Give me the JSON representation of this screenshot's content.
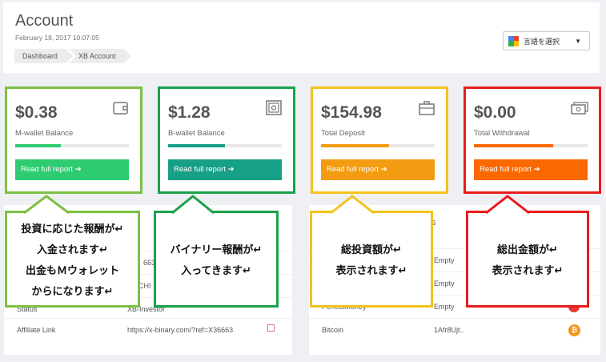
{
  "header": {
    "title": "Account",
    "datetime": "February 18, 2017 10:07:05",
    "breadcrumbs": [
      "Dashboard",
      "XB Account"
    ],
    "language_selector": "言語を選択"
  },
  "cards": [
    {
      "amount": "$0.38",
      "label": "M-wallet Balance",
      "button": "Read full report",
      "icon": "wallet-icon",
      "progress": 0.4,
      "accent": "#2ecc71",
      "outline": "#7dc142"
    },
    {
      "amount": "$1.28",
      "label": "B-wallet Balance",
      "button": "Read full report",
      "icon": "safe-icon",
      "progress": 0.5,
      "accent": "#16a085",
      "outline": "#1aa24a"
    },
    {
      "amount": "$154.98",
      "label": "Total Deposit",
      "button": "Read full report",
      "icon": "briefcase-icon",
      "progress": 0.6,
      "accent": "#f39c12",
      "outline": "#f5c21b"
    },
    {
      "amount": "$0.00",
      "label": "Total Withdrawal",
      "button": "Read full report",
      "icon": "cash-icon",
      "progress": 0.7,
      "accent": "#fa6800",
      "outline": "#e81c1c"
    }
  ],
  "left_panel": {
    "rows": [
      {
        "key": "",
        "value": "663"
      },
      {
        "key": "",
        "value": "CHI"
      },
      {
        "key": "Status",
        "value": "XB-Investor"
      },
      {
        "key": "Affiliate Link",
        "value": "https://x-binary.com/?ref=X36663"
      }
    ]
  },
  "right_panel": {
    "header_fragment": "s",
    "rows": [
      {
        "key": "",
        "value": "Empty"
      },
      {
        "key": "",
        "value": "Empty"
      },
      {
        "key": "PerfectMoney",
        "value": "Empty"
      },
      {
        "key": "Bitcoin",
        "value": "1Afr8Ujt.."
      }
    ]
  },
  "callouts": [
    {
      "lines": [
        "投資に応じた報酬が↵",
        "入金されます↵",
        "出金もＭウォレット",
        "からになります↵"
      ],
      "color": "#7dc142"
    },
    {
      "lines": [
        "バイナリー報酬が↵",
        "入ってきます↵"
      ],
      "color": "#1aa24a"
    },
    {
      "lines": [
        "総投資額が↵",
        "表示されます↵"
      ],
      "color": "#f5c21b"
    },
    {
      "lines": [
        "総出金額が↵",
        "表示されます↵"
      ],
      "color": "#e81c1c"
    }
  ]
}
